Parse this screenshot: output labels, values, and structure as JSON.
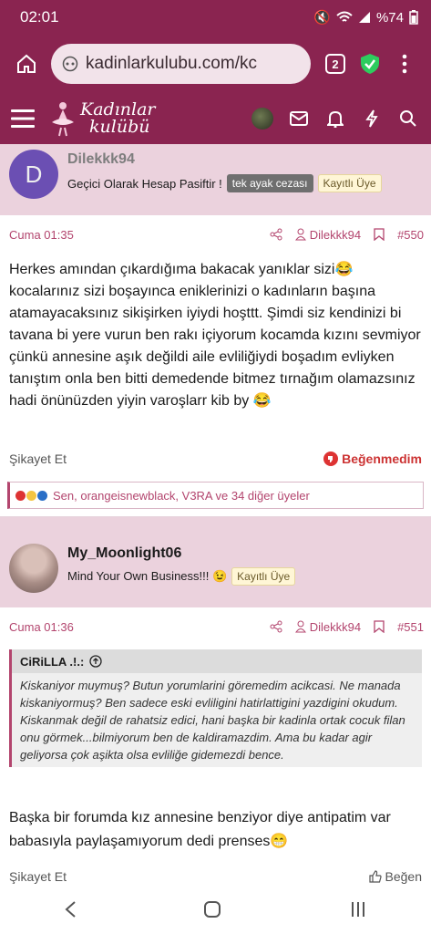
{
  "status": {
    "time": "02:01",
    "battery": "%74"
  },
  "browser": {
    "url": "kadinlarkulubu.com/kc",
    "tab_count": "2"
  },
  "site": {
    "logo_line1": "Kadınlar",
    "logo_line2": "kulübü"
  },
  "posts": [
    {
      "avatar_letter": "D",
      "username": "Dilekkk94",
      "title": "Geçici Olarak Hesap Pasiftir !",
      "ban_badge": "tek ayak cezası",
      "role_badge": "Kayıtlı Üye",
      "date": "Cuma 01:35",
      "author": "Dilekkk94",
      "number": "#550",
      "text": "Herkes amından çıkardığıma bakacak yanıklar sizi😂 kocalarınız sizi boşayınca eniklerinizi o kadınların başına atamayacaksınız sikişirken iyiydi hoşttt. Şimdi siz kendinizi bi tavana bi yere vurun ben rakı içiyorum kocamda kızını sevmiyor çünkü annesine aşık değildi aile evliliğiydi boşadım evliyken tanıştım onla ben bitti demedende bitmez tırnağım olamazsınız hadi önünüzden yiyin varoşlarr kib by 😂",
      "report": "Şikayet Et",
      "dislike": "Beğenmedim",
      "reactions": "Sen, orangeisnewblack, V3RA ve 34 diğer üyeler"
    },
    {
      "username": "My_Moonlight06",
      "title": "Mind Your Own Business!!! 😉",
      "role_badge": "Kayıtlı Üye",
      "date": "Cuma 01:36",
      "author": "Dilekkk94",
      "number": "#551",
      "quote_author": "CiRiLLA .!.:",
      "quote_text": "Kiskaniyor muymuş? Butun yorumlarini göremedim acikcasi. Ne manada kiskaniyormuş? Ben sadece eski evliligini hatirlattigini yazdigini okudum. Kiskanmak değil de rahatsiz edici, hani başka bir kadinla ortak cocuk filan onu görmek...bilmiyorum ben de kaldiramazdim. Ama bu kadar agir geliyorsa çok aşikta olsa evliliğe gidemezdi bence.",
      "text": "Başka bir forumda kız annesine benziyor diye antipatim var babasıyla paylaşamıyorum dedi prenses😁",
      "report": "Şikayet Et",
      "like": "Beğen"
    }
  ],
  "colors": {
    "brand": "#8a2450",
    "accent": "#b3456e",
    "user_bg": "#ebd2dd"
  }
}
